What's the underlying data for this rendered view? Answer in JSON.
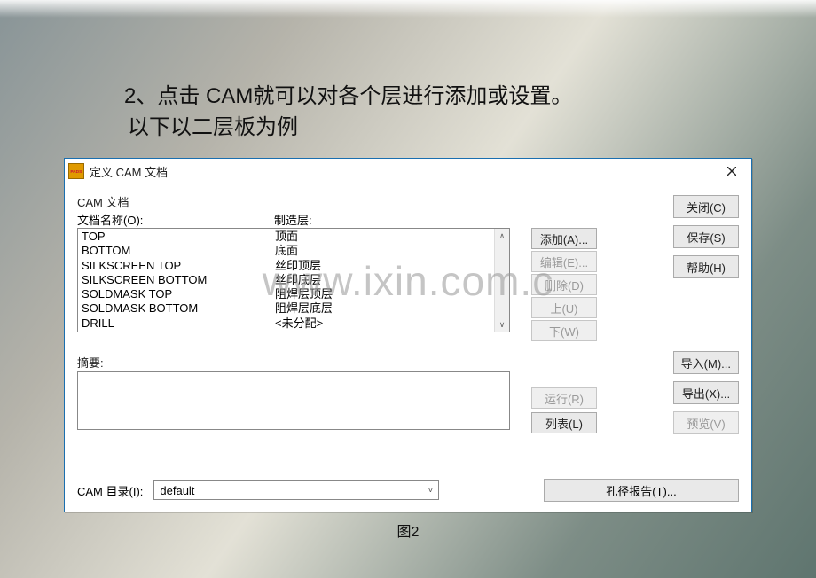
{
  "instruction": {
    "line1": "2、点击 CAM就可以对各个层进行添加或设置。",
    "line2": "以下以二层板为例"
  },
  "watermark": "www.ixin.com.c",
  "dialog": {
    "app_icon_text": "PADS",
    "title": "定义 CAM 文档",
    "group_label": "CAM 文档",
    "doc_name_label": "文档名称(O):",
    "mfg_layer_label": "制造层:",
    "rows": [
      {
        "name": "TOP",
        "layer": "顶面"
      },
      {
        "name": "BOTTOM",
        "layer": "底面"
      },
      {
        "name": "SILKSCREEN TOP",
        "layer": "丝印顶层"
      },
      {
        "name": "SILKSCREEN BOTTOM",
        "layer": "丝印底层"
      },
      {
        "name": "SOLDMASK TOP",
        "layer": "阻焊层顶层"
      },
      {
        "name": "SOLDMASK BOTTOM",
        "layer": "阻焊层底层"
      },
      {
        "name": "DRILL",
        "layer": "<未分配>"
      }
    ],
    "abstract_label": "摘要:",
    "abstract_value": "",
    "side_buttons": {
      "add": "添加(A)...",
      "edit": "编辑(E)...",
      "delete": "删除(D)",
      "up": "上(U)",
      "down": "下(W)",
      "run": "运行(R)",
      "list": "列表(L)"
    },
    "right_buttons": {
      "close": "关闭(C)",
      "save": "保存(S)",
      "help": "帮助(H)",
      "import": "导入(M)...",
      "export": "导出(X)...",
      "preview": "预览(V)"
    },
    "bottom": {
      "dir_label": "CAM 目录(I):",
      "dir_value": "default",
      "hole_report": "孔径报告(T)..."
    }
  },
  "figure_label": "图2"
}
